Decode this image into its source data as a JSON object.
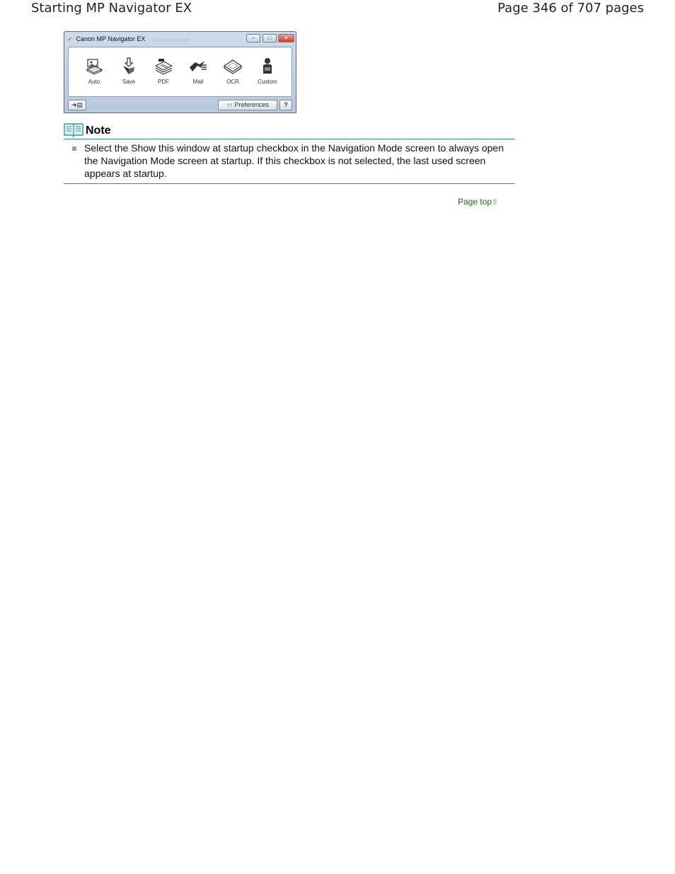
{
  "header": {
    "doc_title": "Starting MP Navigator EX",
    "page_info": "Page 346 of 707 pages"
  },
  "window": {
    "title": "Canon MP Navigator EX",
    "tools": [
      {
        "label": "Auto",
        "icon": "auto-scan-icon"
      },
      {
        "label": "Save",
        "icon": "save-icon"
      },
      {
        "label": "PDF",
        "icon": "pdf-icon"
      },
      {
        "label": "Mail",
        "icon": "mail-icon"
      },
      {
        "label": "OCR",
        "icon": "ocr-icon"
      },
      {
        "label": "Custom",
        "icon": "custom-icon"
      }
    ],
    "preferences_label": "Preferences",
    "help_label": "?"
  },
  "note": {
    "title": "Note",
    "items": [
      "Select the Show this window at startup checkbox in the Navigation Mode screen to always open the Navigation Mode screen at startup. If this checkbox is not selected, the last used screen appears at startup."
    ]
  },
  "page_top_label": "Page top",
  "colors": {
    "note_rule": "#2e8b8b",
    "link": "#157015"
  }
}
